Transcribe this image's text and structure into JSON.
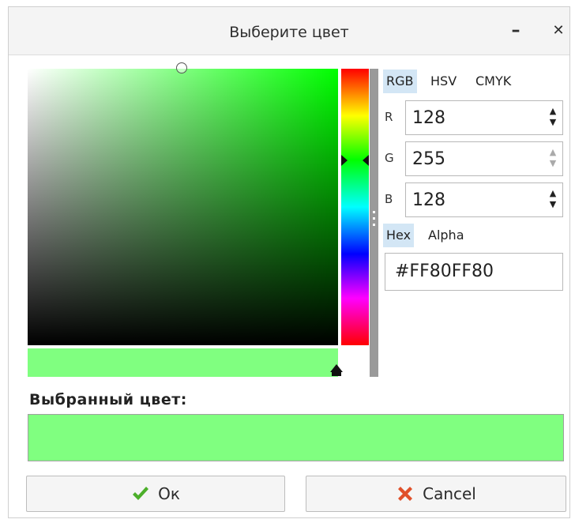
{
  "window": {
    "title": "Выберите цвет",
    "minimize_glyph": "–",
    "close_glyph": "✕"
  },
  "tabs": {
    "rgb": "RGB",
    "hsv": "HSV",
    "cmyk": "CMYK",
    "active": "RGB"
  },
  "channels": [
    {
      "label": "R",
      "value": "128"
    },
    {
      "label": "G",
      "value": "255"
    },
    {
      "label": "B",
      "value": "128"
    }
  ],
  "hex_tabs": {
    "hex": "Hex",
    "alpha": "Alpha",
    "active": "Hex"
  },
  "hex_value": "#FF80FF80",
  "selected_label": "Выбранный цвет:",
  "selected_color": "#80ff80",
  "buttons": {
    "ok": "Ок",
    "ok_icon": "checkmark-icon",
    "cancel": "Cancel",
    "cancel_icon": "cross-icon"
  },
  "colors": {
    "hue_base": "#00ff00",
    "tab_active_bg": "#d3e6f5",
    "ok_icon": "#4caf2a",
    "cancel_icon": "#e0502a"
  }
}
